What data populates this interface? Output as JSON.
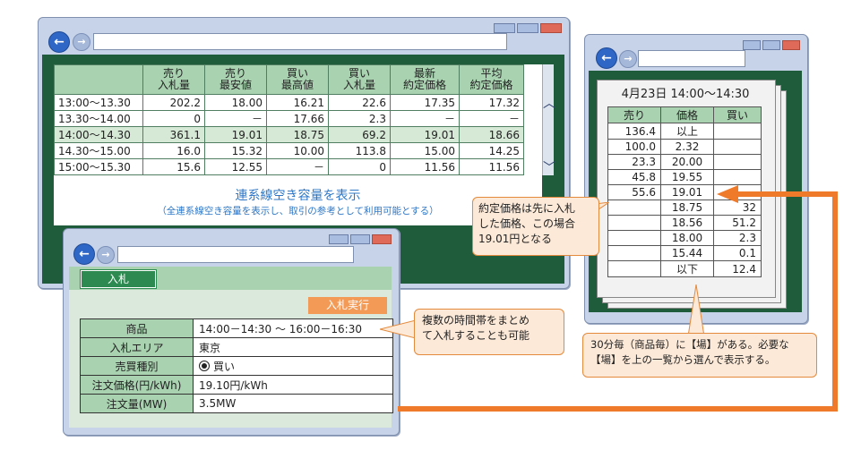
{
  "main_window": {
    "table": {
      "headers": [
        [
          "",
          ""
        ],
        [
          "売り",
          "入札量"
        ],
        [
          "売り",
          "最安値"
        ],
        [
          "買い",
          "最高値"
        ],
        [
          "買い",
          "入札量"
        ],
        [
          "最新",
          "約定価格"
        ],
        [
          "平均",
          "約定価格"
        ]
      ],
      "rows": [
        [
          "13:00〜13.30",
          "202.2",
          "18.00",
          "16.21",
          "22.6",
          "17.35",
          "17.32"
        ],
        [
          "13.30〜14.00",
          "0",
          "－",
          "17.66",
          "2.3",
          "－",
          "－"
        ],
        [
          "14:00〜14.30",
          "361.1",
          "19.01",
          "18.75",
          "69.2",
          "19.01",
          "18.66"
        ],
        [
          "14.30〜15.00",
          "16.0",
          "15.32",
          "10.00",
          "113.8",
          "15.00",
          "14.25"
        ],
        [
          "15:00〜15.30",
          "15.6",
          "12.55",
          "－",
          "0",
          "11.56",
          "11.56"
        ]
      ]
    },
    "link_title": "連系線空き容量を表示",
    "link_subtitle": "（全連系線空き容量を表示し、取引の参考として利用可能とする）"
  },
  "order_book": {
    "title": "4月23日 14:00〜14:30",
    "headers": [
      "売り",
      "価格",
      "買い"
    ],
    "rows": [
      [
        "136.4",
        "以上",
        ""
      ],
      [
        "100.0",
        "2.32",
        ""
      ],
      [
        "23.3",
        "20.00",
        ""
      ],
      [
        "45.8",
        "19.55",
        ""
      ],
      [
        "55.6",
        "19.01",
        ""
      ],
      [
        "",
        "18.75",
        "32"
      ],
      [
        "",
        "18.56",
        "51.2"
      ],
      [
        "",
        "18.00",
        "2.3"
      ],
      [
        "",
        "15.44",
        "0.1"
      ],
      [
        "",
        "以下",
        "12.4"
      ]
    ]
  },
  "callouts": {
    "contract": [
      "約定価格は先に入札",
      "した価格、この場合",
      "19.01円となる"
    ],
    "multi": [
      "複数の時間帯をまとめ",
      "て入札することも可能"
    ],
    "market": [
      "30分毎（商品毎）に【場】がある。必要な",
      "【場】を上の一覧から選んで表示する。"
    ]
  },
  "bid_window": {
    "tab_label": "入札",
    "execute_label": "入札実行",
    "fields": [
      {
        "label": "商品",
        "value": "14:00－14:30 ～ 16:00－16:30"
      },
      {
        "label": "入札エリア",
        "value": "東京"
      },
      {
        "label": "売買種別",
        "value": "買い"
      },
      {
        "label": "注文価格(円/kWh)",
        "value": "19.10円/kWh"
      },
      {
        "label": "注文量(MW)",
        "value": "3.5MW"
      }
    ]
  },
  "colors": {
    "accent_orange": "#ef7a2a",
    "panel_green": "#1f5c3b",
    "header_green": "#a9d2b0",
    "link_blue": "#2e77c7"
  }
}
